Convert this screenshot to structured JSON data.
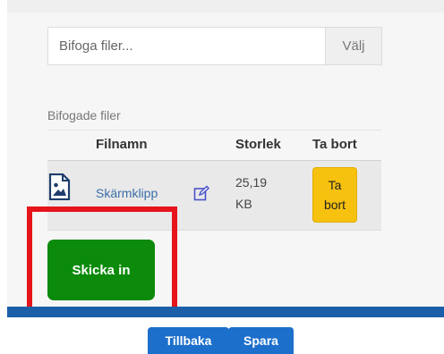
{
  "attach": {
    "placeholder": "Bifoga filer...",
    "choose_label": "Välj"
  },
  "attached_files": {
    "label": "Bifogade filer",
    "columns": [
      "Filnamn",
      "Storlek",
      "Ta bort"
    ],
    "rows": [
      {
        "name": "Skärmklipp",
        "size_line1": "25,19",
        "size_line2": "KB",
        "delete_line1": "Ta",
        "delete_line2": "bort"
      }
    ]
  },
  "submit_label": "Skicka in",
  "footer": {
    "back_label": "Tillbaka",
    "save_label": "Spara"
  },
  "colors": {
    "submit": "#0b8a0b",
    "delete": "#f7c10f",
    "highlight": "#e6141b",
    "bar": "#1b5fa8",
    "footer_buttons": "#1d6fcc"
  }
}
